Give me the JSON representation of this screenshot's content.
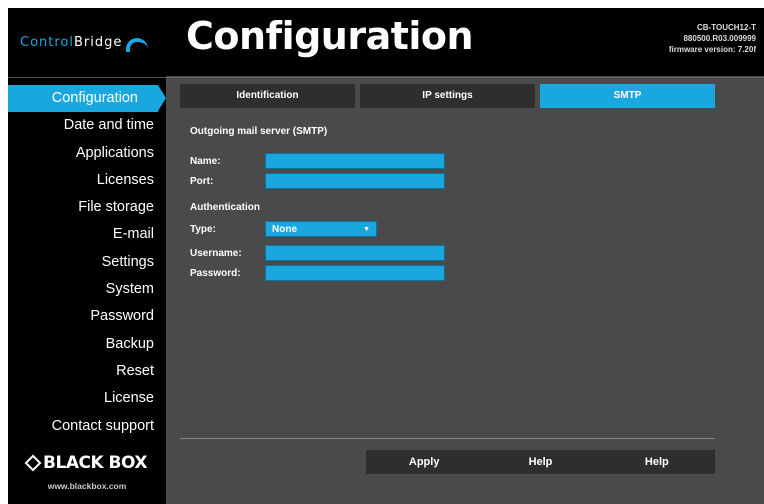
{
  "logo": {
    "part1": "Control",
    "part2": "Bridge"
  },
  "nav": {
    "items": [
      {
        "label": "Configuration"
      },
      {
        "label": "Date and time"
      },
      {
        "label": "Applications"
      },
      {
        "label": "Licenses"
      },
      {
        "label": "File storage"
      },
      {
        "label": "E-mail"
      },
      {
        "label": "Settings"
      },
      {
        "label": "System"
      },
      {
        "label": "Password"
      },
      {
        "label": "Backup"
      },
      {
        "label": "Reset"
      },
      {
        "label": "License"
      },
      {
        "label": "Contact support"
      }
    ],
    "active_index": 0
  },
  "brand": {
    "name": "BLACK BOX",
    "url": "www.blackbox.com"
  },
  "header": {
    "title": "Configuration",
    "device_model": "CB-TOUCH12-T",
    "device_serial": "880500.R03.009999",
    "firmware": "firmware version: 7.20f"
  },
  "tabs": [
    {
      "label": "Identification",
      "active": false
    },
    {
      "label": "IP settings",
      "active": false
    },
    {
      "label": "SMTP",
      "active": true
    }
  ],
  "form": {
    "server_section": "Outgoing mail server (SMTP)",
    "name_label": "Name:",
    "name_value": "",
    "port_label": "Port:",
    "port_value": "",
    "auth_section": "Authentication",
    "type_label": "Type:",
    "type_value": "None",
    "username_label": "Username:",
    "username_value": "",
    "password_label": "Password:",
    "password_value": ""
  },
  "footer": {
    "apply_label": "Apply",
    "help_label_1": "Help",
    "help_label_2": "Help"
  },
  "colors": {
    "accent": "#1aa7e0",
    "sidebar_bg": "#000000",
    "content_bg": "#4a4a4a",
    "button_bg": "#2e2e2e"
  }
}
